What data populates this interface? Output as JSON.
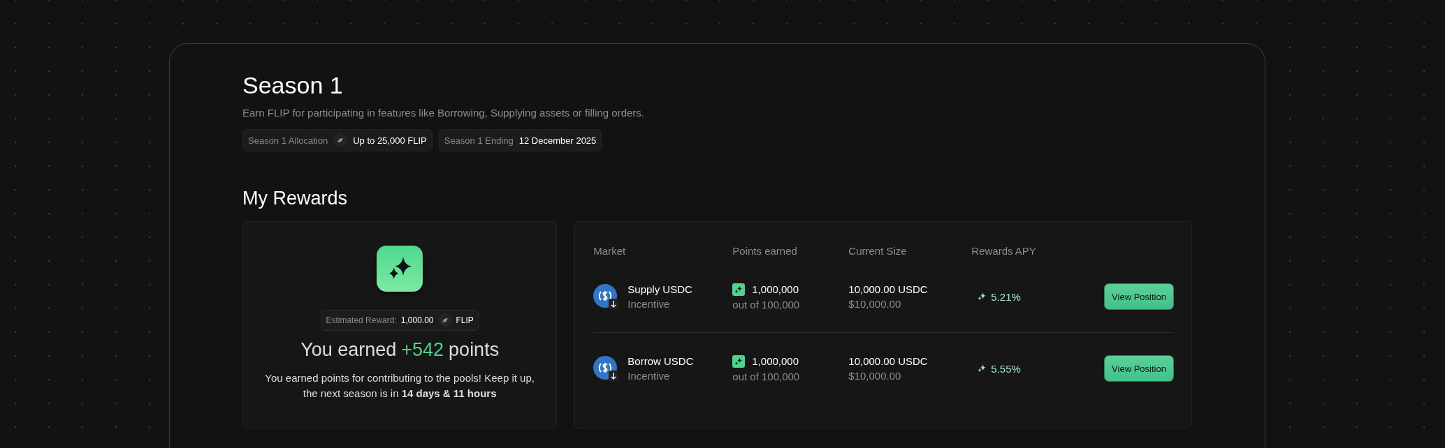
{
  "season": {
    "title": "Season 1",
    "subtitle": "Earn FLIP for participating in features like Borrowing, Supplying assets or filling orders.",
    "chips": [
      {
        "label": "Season 1 Allocation",
        "value": "Up to 25,000 FLIP",
        "kind": "token"
      },
      {
        "label": "Season 1 Ending",
        "value": "12 December 2025",
        "kind": "plain"
      }
    ]
  },
  "rewards": {
    "title": "My Rewards",
    "summary": {
      "estimate_label": "Estimated Reward:",
      "estimate_value": "1,000.00",
      "estimate_token": "FLIP",
      "earned_prefix": "You earned",
      "earned_value": "+542",
      "earned_suffix": "points",
      "note": "You earned points for contributing to the pools! Keep it up, the next season is in **14 days & 11 hours**"
    },
    "table": {
      "columns": [
        "Market",
        "Points earned",
        "Current Size",
        "Rewards APY"
      ],
      "rows": [
        {
          "market": "Supply USDC",
          "type": "Incentive",
          "points": "1,000,000",
          "points_total": "out of 100,000",
          "size": "10,000.00 USDC",
          "size_usd": "$10,000.00",
          "apy": "5.21%",
          "action": "View Position"
        },
        {
          "market": "Borrow USDC",
          "type": "Incentive",
          "points": "1,000,000",
          "points_total": "out of 100,000",
          "size": "10,000.00 USDC",
          "size_usd": "$10,000.00",
          "apy": "5.55%",
          "action": "View Position"
        }
      ]
    }
  }
}
